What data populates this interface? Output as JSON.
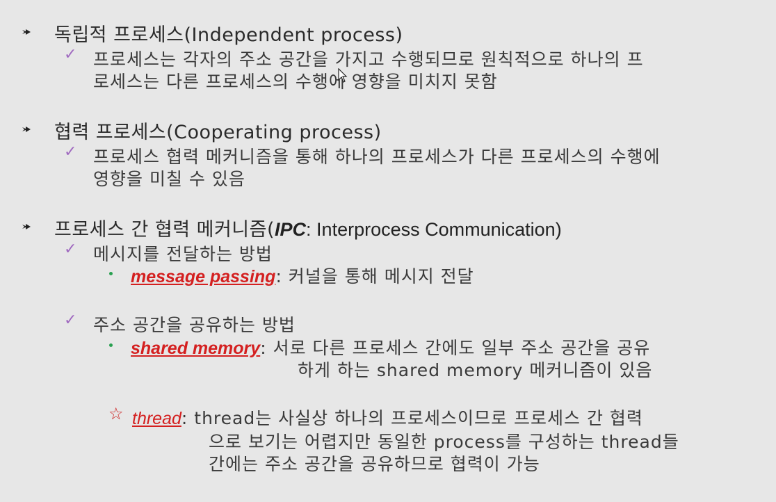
{
  "section1": {
    "heading": "독립적 프로세스(Independent process)",
    "sub1": {
      "line1": "프로세스는 각자의 주소 공간을  가지고 수행되므로 원칙적으로 하나의 프",
      "line2": "로세스는 다른 프로세스의 수행에 영향을 미치지 못함"
    }
  },
  "section2": {
    "heading": "협력 프로세스(Cooperating process)",
    "sub1": {
      "line1": "프로세스 협력 메커니즘을 통해 하나의 프로세스가 다른 프로세스의 수행에",
      "line2": "영향을 미칠 수 있음"
    }
  },
  "section3": {
    "heading_prefix": "프로세스 간 협력 메커니즘(",
    "heading_ipc": "IPC",
    "heading_suffix": ": Interprocess Communication)",
    "method1": {
      "label": "메시지를 전달하는 방법",
      "keyword": "message passing",
      "desc": ":  커널을 통해 메시지 전달"
    },
    "method2": {
      "label": "주소 공간을 공유하는 방법",
      "keyword": "shared memory",
      "desc_line1": ":  서로 다른 프로세스 간에도 일부 주소 공간을 공유",
      "desc_line2": "하게 하는 shared memory 메커니즘이 있음"
    },
    "note": {
      "star": "☆",
      "keyword": "thread",
      "line1": ":  thread는 사실상 하나의 프로세스이므로 프로세스 간 협력",
      "line2": "으로 보기는 어렵지만 동일한 process를 구성하는 thread들",
      "line3": "간에는 주소 공간을 공유하므로 협력이 가능"
    }
  }
}
